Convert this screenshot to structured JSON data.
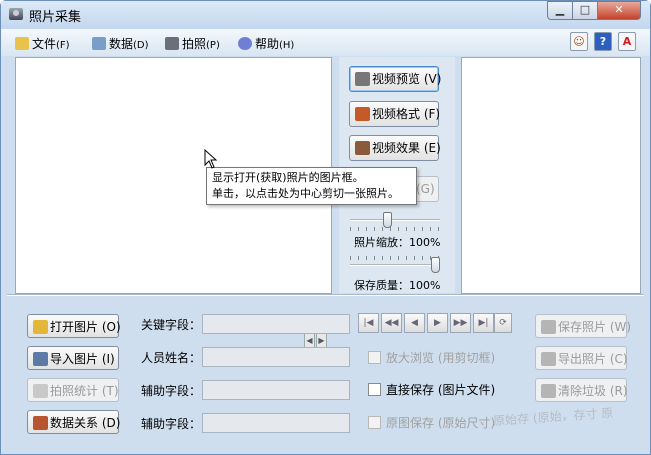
{
  "window": {
    "title": "照片采集"
  },
  "menu": [
    {
      "label": "文件",
      "shortcut": "(F)",
      "icon": "folder-icon"
    },
    {
      "label": "数据",
      "shortcut": "(D)",
      "icon": "database-icon"
    },
    {
      "label": "拍照",
      "shortcut": "(P)",
      "icon": "camera-icon"
    },
    {
      "label": "帮助",
      "shortcut": "(H)",
      "icon": "help-globe-icon"
    }
  ],
  "video_buttons": {
    "preview": "视频预览 (V)",
    "format": "视频格式 (F)",
    "effect": "视频效果 (E)"
  },
  "capture_button_hotkey": "(G)",
  "sliders": {
    "zoom_label": "照片缩放：100%",
    "quality_label": "保存质量：100%",
    "zoom_percent": 100,
    "quality_percent": 100
  },
  "tooltip": {
    "line1": "显示打开(获取)照片的图片框。",
    "line2": "单击，以点击处为中心剪切一张照片。"
  },
  "left_buttons": {
    "open": "打开图片 (O)",
    "import": "导入图片 (I)",
    "stats": "拍照统计 (T)",
    "relation": "数据关系 (D)"
  },
  "fields": {
    "key_field": "关键字段：",
    "person_name": "人员姓名：",
    "aux_field_1": "辅助字段：",
    "aux_field_2": "辅助字段："
  },
  "checkboxes": {
    "zoom_browse": "放大浏览 (用剪切框)",
    "direct_save": "直接保存 (图片文件)",
    "original_save": "原图保存 (原始尺寸)"
  },
  "right_buttons": {
    "save_photo": "保存照片 (W)",
    "export_photo": "导出照片 (C)",
    "clear_trash": "清除垃圾 (R)"
  },
  "ghost_text": "原始存 (原始，存寸 原"
}
